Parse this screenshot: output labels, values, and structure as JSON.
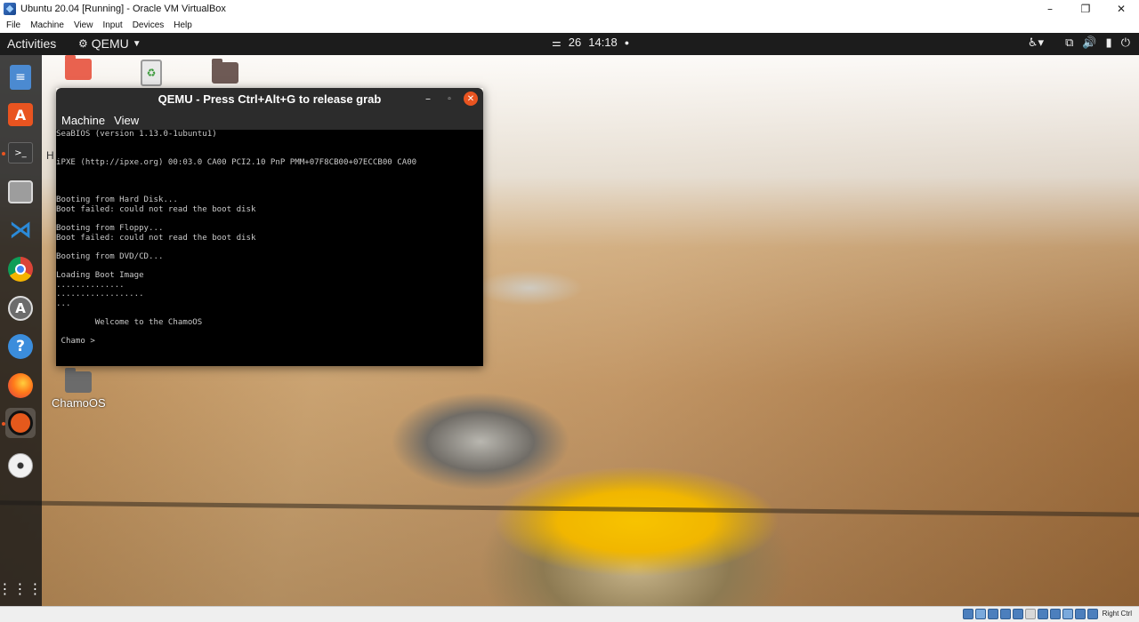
{
  "host_window": {
    "title": "Ubuntu 20.04 [Running] - Oracle VM VirtualBox",
    "controls": {
      "minimize": "–",
      "maximize": "❐",
      "close": "✕"
    },
    "menu": [
      "File",
      "Machine",
      "View",
      "Input",
      "Devices",
      "Help"
    ],
    "status_hostkey": "Right Ctrl"
  },
  "topbar": {
    "activities": "Activities",
    "app_name": "QEMU",
    "date": "26",
    "time": "14:18"
  },
  "dock": {
    "items": [
      "text-editor",
      "ubuntu-software",
      "terminal",
      "files",
      "vs-code",
      "chrome",
      "software-updater",
      "help",
      "firefox",
      "qemu",
      "dvd",
      "show-applications"
    ]
  },
  "desktop": {
    "icons": [
      {
        "name": "home-folder",
        "label": ""
      },
      {
        "name": "trash",
        "label": ""
      },
      {
        "name": "folder",
        "label": ""
      },
      {
        "name": "chamoos-folder",
        "label": "ChamoOS"
      }
    ],
    "stray_text": "H"
  },
  "qemu": {
    "title": "QEMU - Press Ctrl+Alt+G to release grab",
    "menu": [
      "Machine",
      "View"
    ],
    "console": "SeaBIOS (version 1.13.0-1ubuntu1)\n\n\niPXE (http://ipxe.org) 00:03.0 CA00 PCI2.10 PnP PMM+07F8CB00+07ECCB00 CA00\n\n\n\nBooting from Hard Disk...\nBoot failed: could not read the boot disk\n\nBooting from Floppy...\nBoot failed: could not read the boot disk\n\nBooting from DVD/CD...\n\nLoading Boot Image\n..............\n..................\n...\n\n        Welcome to the ChamoOS\n\n Chamo >"
  }
}
